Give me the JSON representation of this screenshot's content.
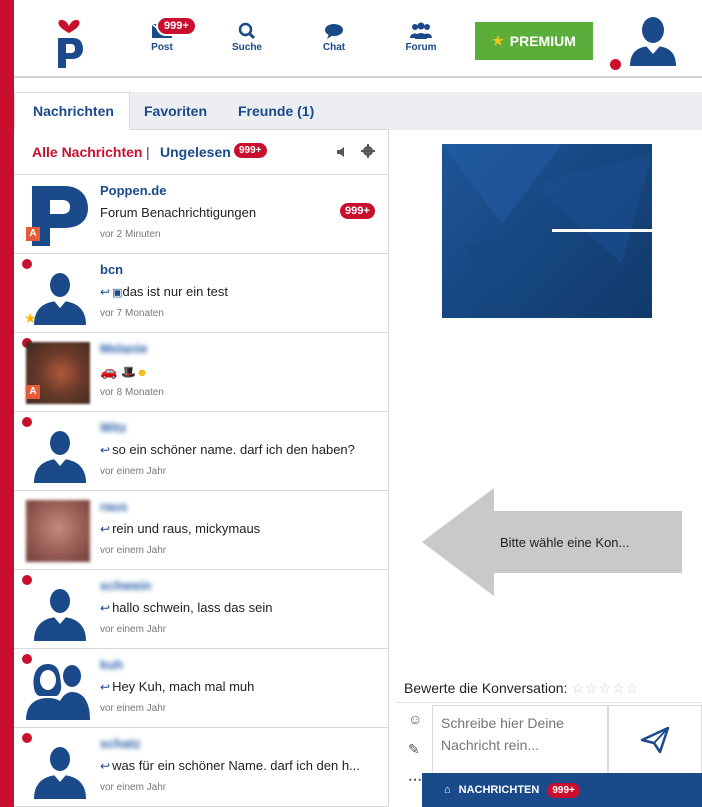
{
  "header": {
    "nav": [
      {
        "label": "Post",
        "icon": "mail-icon",
        "badge": "999+"
      },
      {
        "label": "Suche",
        "icon": "search-icon"
      },
      {
        "label": "Chat",
        "icon": "chat-icon"
      },
      {
        "label": "Forum",
        "icon": "forum-icon"
      }
    ],
    "premium_label": "PREMIUM"
  },
  "tabs": [
    {
      "label": "Nachrichten",
      "active": true
    },
    {
      "label": "Favoriten",
      "active": false
    },
    {
      "label": "Freunde (1)",
      "active": false
    }
  ],
  "filters": {
    "all": "Alle Nachrichten",
    "separator": "|",
    "unread": "Ungelesen",
    "unread_count": "999+"
  },
  "conversations": [
    {
      "name": "Poppen.de",
      "message": "Forum Benachrichtigungen",
      "time": "vor 2 Minuten",
      "count": "999+"
    },
    {
      "name": "bcn",
      "message": "das ist nur ein test",
      "time": "vor 7 Monaten"
    },
    {
      "name": "Melanie",
      "message": "",
      "time": "vor 8 Monaten"
    },
    {
      "name": "Witz",
      "message": "so ein schöner name. darf ich den haben?",
      "time": "vor einem Jahr"
    },
    {
      "name": "raus",
      "message": "rein und raus, mickymaus",
      "time": "vor einem Jahr"
    },
    {
      "name": "schwein",
      "message": "hallo schwein, lass das sein",
      "time": "vor einem Jahr"
    },
    {
      "name": "kuh",
      "message": "Hey Kuh, mach mal muh",
      "time": "vor einem Jahr"
    },
    {
      "name": "schatz",
      "message": "was für ein schöner Name. darf ich den h...",
      "time": "vor einem Jahr"
    }
  ],
  "hint_text": "Bitte wähle eine Kon...",
  "rating_label": "Bewerte die Konversation:",
  "rating_stars": "☆☆☆☆☆",
  "composer_placeholder": "Schreibe hier Deine Nachricht rein...",
  "notification_bar": {
    "label": "NACHRICHTEN",
    "count": "999+"
  },
  "colors": {
    "brand_red": "#c8102e",
    "brand_blue": "#1a4a8a",
    "premium_green": "#5cae3a"
  }
}
